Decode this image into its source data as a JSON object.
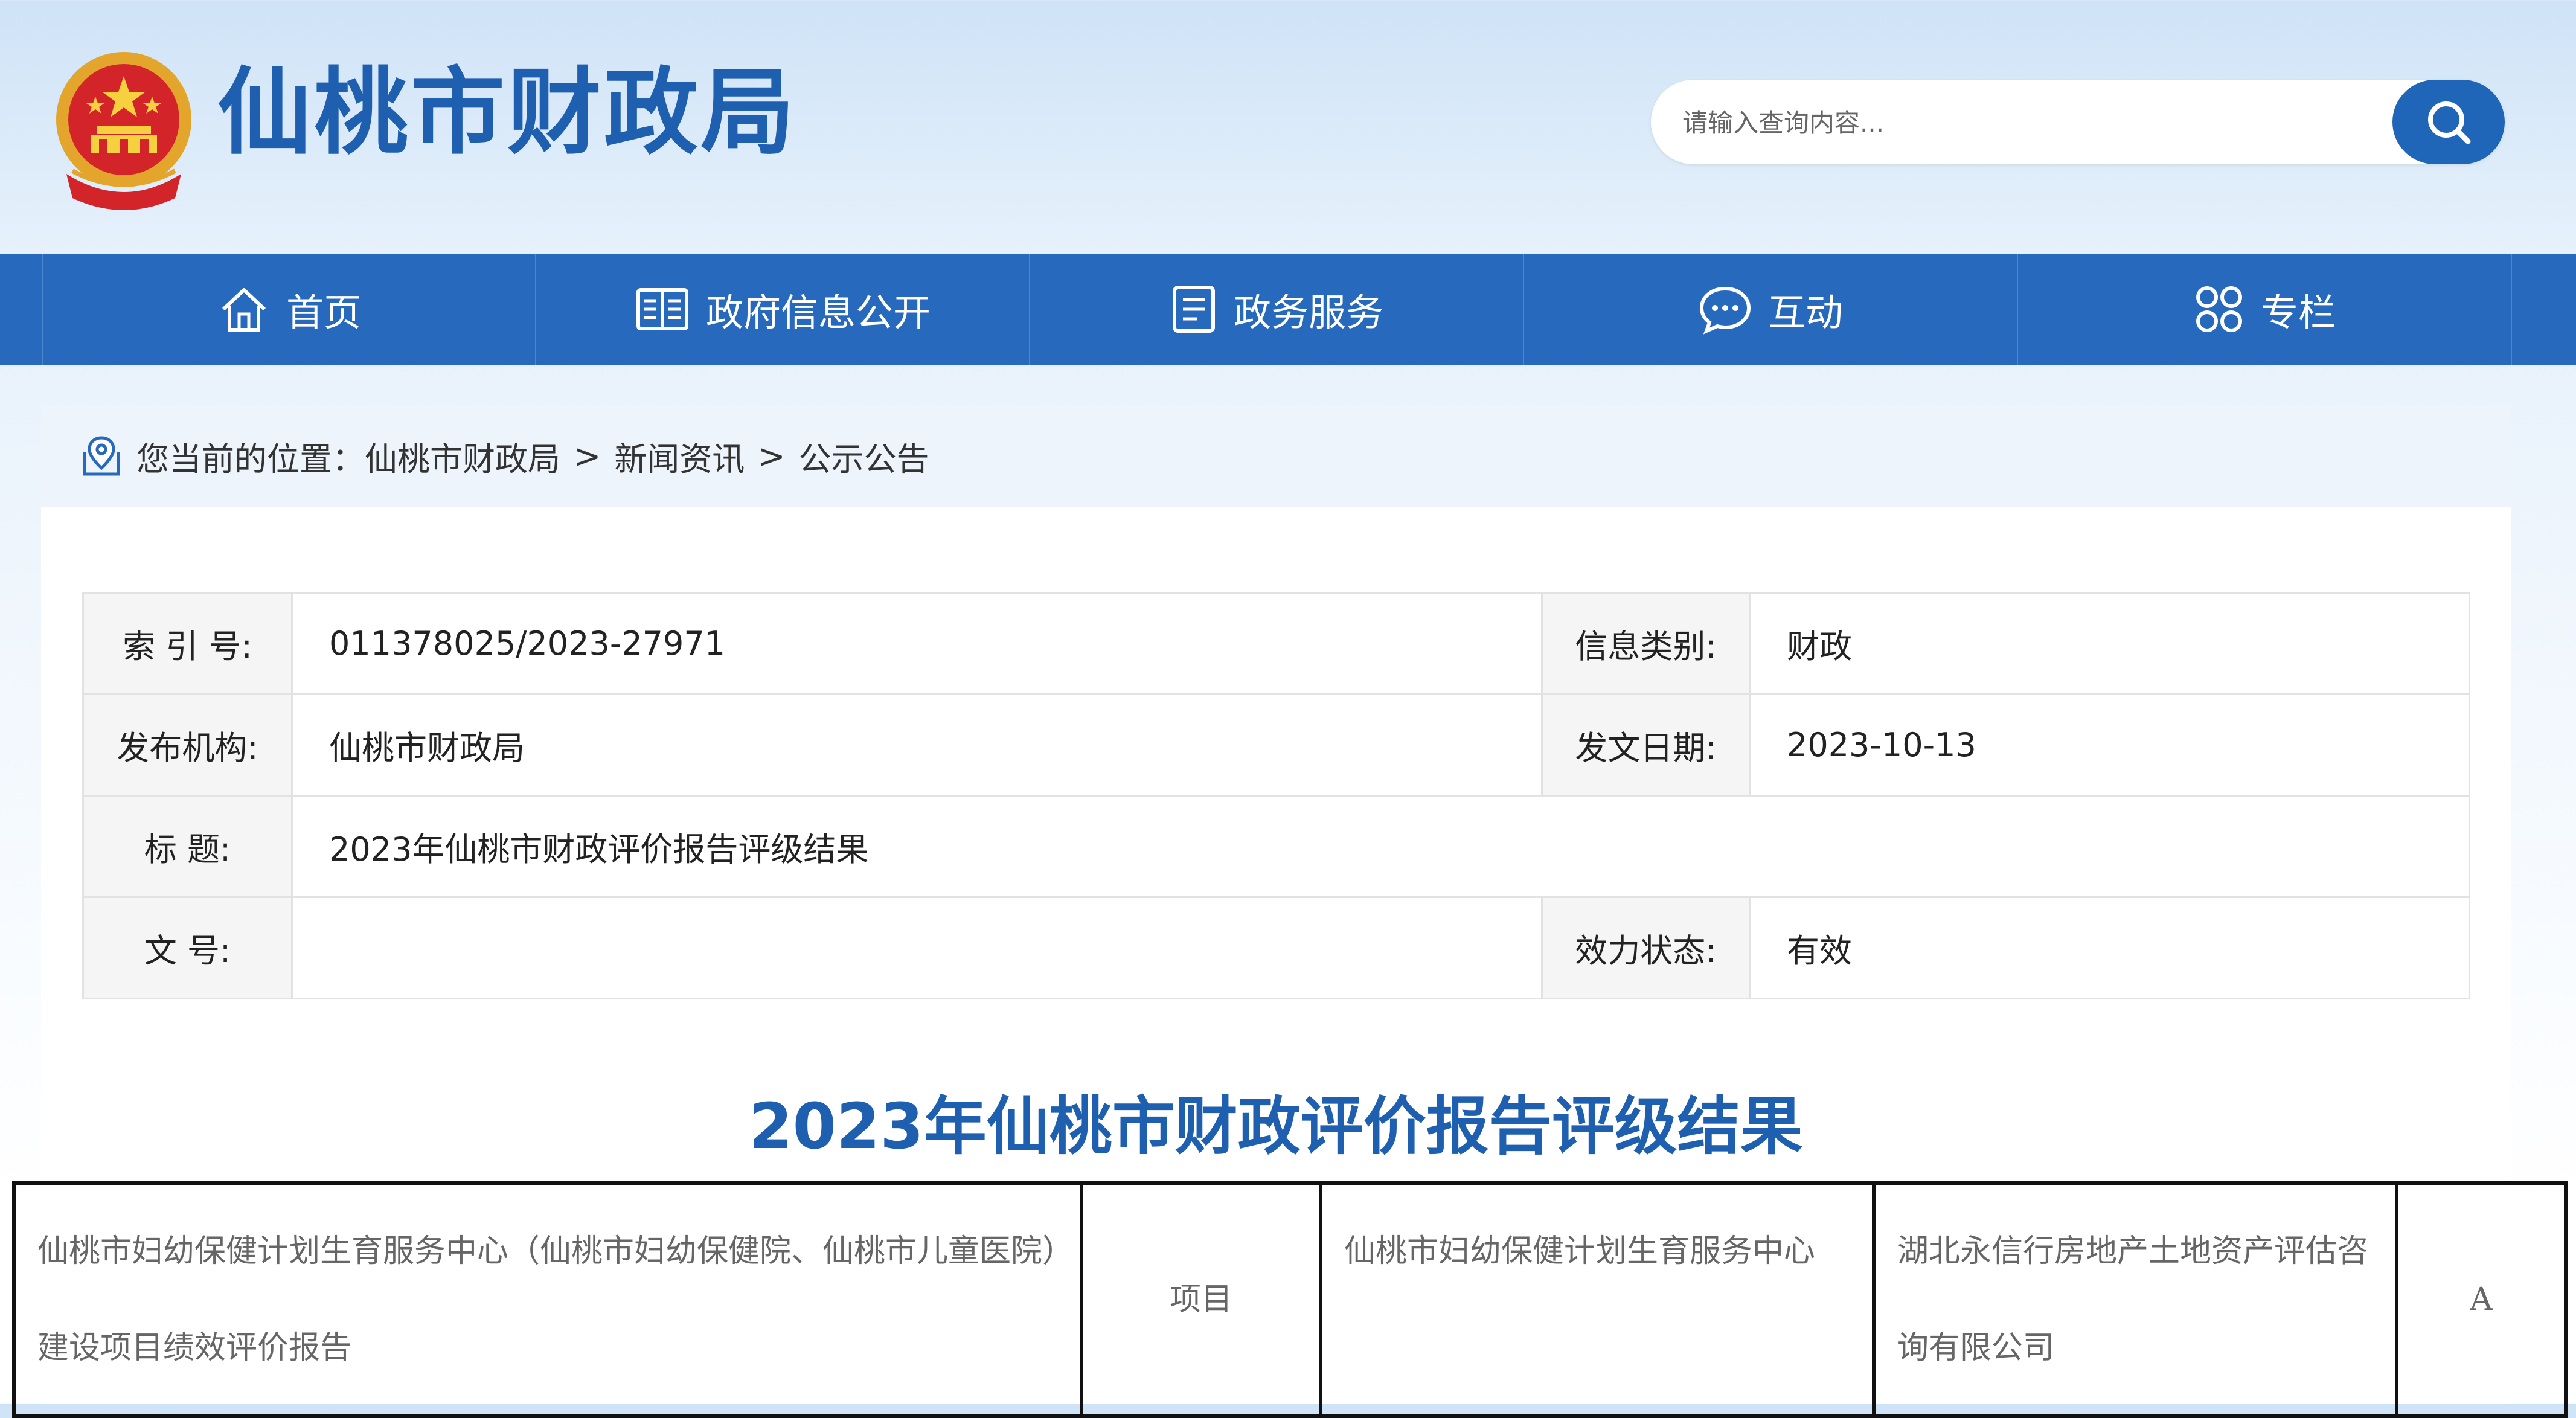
{
  "header": {
    "site_title": "仙桃市财政局",
    "search_placeholder": "请输入查询内容..."
  },
  "nav": {
    "items": [
      {
        "label": "首页",
        "icon": "home-icon"
      },
      {
        "label": "政府信息公开",
        "icon": "book-icon"
      },
      {
        "label": "政务服务",
        "icon": "document-list-icon"
      },
      {
        "label": "互动",
        "icon": "chat-icon"
      },
      {
        "label": "专栏",
        "icon": "grid-clover-icon"
      }
    ]
  },
  "breadcrumb": {
    "prefix": "您当前的位置：",
    "items": [
      "仙桃市财政局",
      "新闻资讯",
      "公示公告"
    ],
    "separator": ">"
  },
  "meta": {
    "index_label": "索 引 号:",
    "index_value": "011378025/2023-27971",
    "category_label": "信息类别:",
    "category_value": "财政",
    "publisher_label": "发布机构:",
    "publisher_value": "仙桃市财政局",
    "date_label": "发文日期:",
    "date_value": "2023-10-13",
    "title_label": "标 题:",
    "title_value": "2023年仙桃市财政评价报告评级结果",
    "docno_label": "文 号:",
    "docno_value": "",
    "status_label": "效力状态:",
    "status_value": "有效"
  },
  "article": {
    "title": "2023年仙桃市财政评价报告评级结果"
  },
  "result_table": {
    "rows": [
      {
        "report": "仙桃市妇幼保健计划生育服务中心（仙桃市妇幼保健院、仙桃市儿童医院）建设项目绩效评价报告",
        "type": "项目",
        "unit": "仙桃市妇幼保健计划生育服务中心",
        "agency": "湖北永信行房地产土地资产评估咨询有限公司",
        "grade": "A"
      }
    ]
  },
  "colors": {
    "brand_blue": "#1f5fb0",
    "nav_blue": "#2669bd",
    "search_button": "#1f65b8"
  }
}
